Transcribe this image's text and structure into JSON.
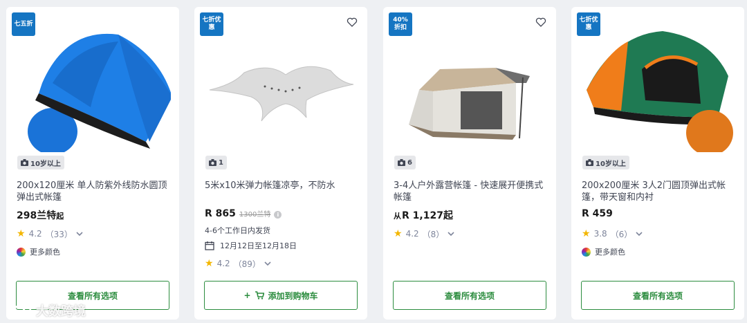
{
  "products": [
    {
      "badge": "七五折",
      "photo_count": "10岁以上",
      "title": "200x120厘米 单人防紫外线防水圆顶弹出式帐篷",
      "price": "298兰特",
      "price_suffix": "起",
      "rating": "4.2",
      "reviews": "（33）",
      "more_colors": "更多颜色",
      "button": "查看所有选项"
    },
    {
      "badge": "七折优惠",
      "photo_count": "1",
      "title": "5米x10米弹力帐篷凉亭，不防水",
      "price": "R 865",
      "old_price": "1300兰特",
      "shipping": "4-6个工作日内发货",
      "delivery_date": "12月12日至12月18日",
      "rating": "4.2",
      "reviews": "（89）",
      "button": "添加到购物车"
    },
    {
      "badge": "40%折扣",
      "photo_count": "6",
      "title": "3-4人户外露营帐篷 - 快速展开便携式帐篷",
      "price_prefix": "从",
      "price": "R 1,127起",
      "rating": "4.2",
      "reviews": "（8）",
      "button": "查看所有选项"
    },
    {
      "badge": "七折优惠",
      "photo_count": "10岁以上",
      "title": "200x200厘米 3人2门圆顶弹出式帐篷，带天窗和内衬",
      "price": "R 459",
      "rating": "3.8",
      "reviews": "（6）",
      "more_colors": "更多颜色",
      "button": "查看所有选项"
    }
  ],
  "watermark": "大数跨境",
  "colors": {
    "badge": "#1575c2",
    "button": "#2b8c3e",
    "star": "#f3b600"
  }
}
